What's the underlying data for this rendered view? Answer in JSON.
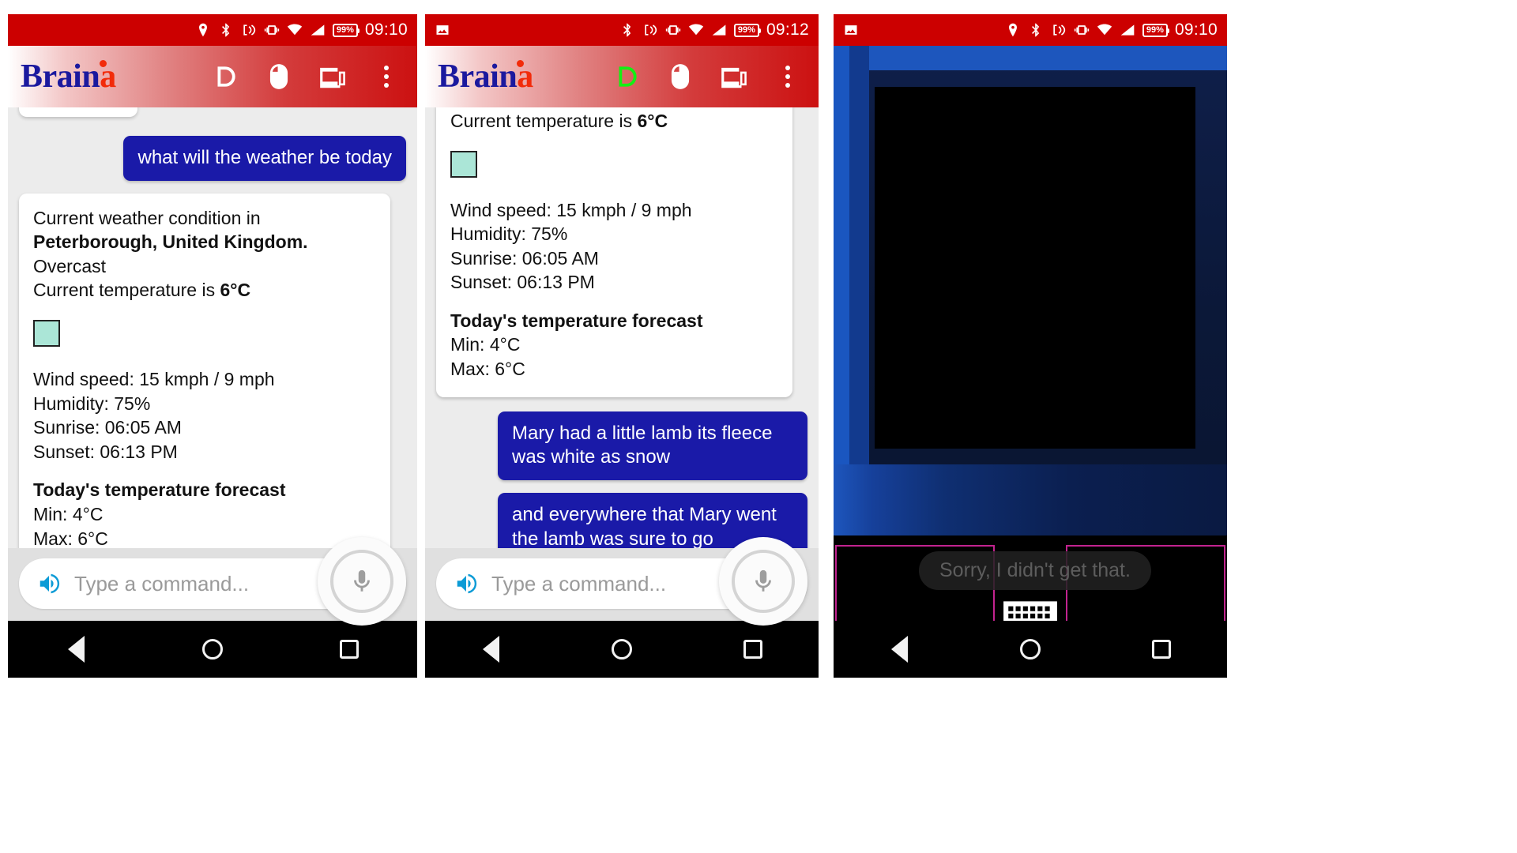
{
  "app": {
    "name": "Braina",
    "logo_part_blue": "Brain",
    "logo_part_red": "a"
  },
  "panels": [
    {
      "id": "panel-weather",
      "status": {
        "time": "09:10",
        "battery": "99%",
        "icons": [
          "location-icon",
          "bluetooth-icon",
          "nfc-icon",
          "vibrate-icon",
          "wifi-icon",
          "signal-icon",
          "battery-icon"
        ],
        "has_image_icon": false
      },
      "appbar": {
        "icons": [
          "dictation-icon",
          "mouse-icon",
          "cast-icon",
          "overflow-menu-icon"
        ],
        "dictation_active": false
      },
      "messages": [
        {
          "role": "user",
          "text": "what will the weather be today"
        }
      ],
      "weather_card": {
        "line1": "Current weather condition in",
        "location": "Peterborough, United Kingdom.",
        "condition": "Overcast",
        "temp_prefix": "Current temperature is ",
        "temp_value": "6°C",
        "swatch_color": "#abe6d7",
        "wind": "Wind speed: 15 kmph / 9 mph",
        "humidity": "Humidity: 75%",
        "sunrise": "Sunrise: 06:05 AM",
        "sunset": "Sunset: 06:13 PM",
        "forecast_heading": "Today's temperature forecast",
        "forecast_min": "Min: 4°C",
        "forecast_max": "Max: 6°C"
      },
      "input": {
        "placeholder": "Type a command...",
        "value": ""
      },
      "nav": [
        "back-button",
        "home-button",
        "recents-button"
      ]
    },
    {
      "id": "panel-dictation",
      "status": {
        "time": "09:12",
        "battery": "99%",
        "icons": [
          "image-icon",
          "bluetooth-icon",
          "nfc-icon",
          "vibrate-icon",
          "wifi-icon",
          "signal-icon",
          "battery-icon"
        ],
        "has_image_icon": true
      },
      "appbar": {
        "icons": [
          "dictation-icon",
          "mouse-icon",
          "cast-icon",
          "overflow-menu-icon"
        ],
        "dictation_active": true
      },
      "weather_card_partial": {
        "temp_prefix": "Current temperature is ",
        "temp_value": "6°C",
        "swatch_color": "#abe6d7",
        "wind": "Wind speed: 15 kmph / 9 mph",
        "humidity": "Humidity: 75%",
        "sunrise": "Sunrise: 06:05 AM",
        "sunset": "Sunset: 06:13 PM",
        "forecast_heading": "Today's temperature forecast",
        "forecast_min": "Min: 4°C",
        "forecast_max": "Max: 6°C"
      },
      "messages": [
        {
          "role": "user",
          "text": "Mary had a little lamb its fleece was white as snow"
        },
        {
          "role": "user",
          "text": "and everywhere that Mary went the lamb was sure to go"
        }
      ],
      "input": {
        "placeholder": "Type a command...",
        "value": ""
      },
      "nav": [
        "back-button",
        "home-button",
        "recents-button"
      ]
    },
    {
      "id": "panel-screen-mirror",
      "status": {
        "time": "09:10",
        "battery": "99%",
        "icons": [
          "image-icon",
          "location-icon",
          "bluetooth-icon",
          "nfc-icon",
          "vibrate-icon",
          "wifi-icon",
          "signal-icon",
          "battery-icon"
        ],
        "has_image_icon": true
      },
      "toast": "Sorry, I didn't get that.",
      "keyboard_icon": "keyboard-icon",
      "nav": [
        "back-button",
        "home-button",
        "recents-button"
      ]
    }
  ],
  "colors": {
    "status_red": "#cc0000",
    "user_bubble": "#1a1aa8",
    "logo_blue": "#1b199e",
    "logo_red": "#f22b0a",
    "dictation_green": "#13f013",
    "speaker_blue": "#0c9bd6",
    "frame_magenta": "#c2238f"
  }
}
